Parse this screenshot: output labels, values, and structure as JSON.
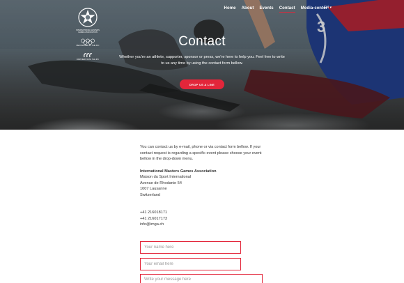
{
  "nav": {
    "items": [
      {
        "label": "Home",
        "active": false
      },
      {
        "label": "About",
        "active": false
      },
      {
        "label": "Events",
        "active": false
      },
      {
        "label": "Contact",
        "active": true
      },
      {
        "label": "Media-center",
        "active": false
      }
    ],
    "language": "EN ▾",
    "accent_color": "#e3263a"
  },
  "logos": {
    "main_text": "International Masters Games Association",
    "ioc_text": "Recognised by the IOC",
    "ipc_text": "Partners with the IPC"
  },
  "hero": {
    "title": "Contact",
    "subtitle": "Whether you're an athlete, supporter, sponsor or press, we're here to help you. Feel free to write to us any time by using the contact form bellow.",
    "button_label": "DROP US A LINE"
  },
  "content": {
    "intro": "You can contact us by e-mail, phone or via contact form bellow. If your contact request is regarding a specific event please choose your event bellow in the drop-down menu.",
    "org_name": "International Masters Games Association",
    "address": [
      "Maison du Sport International",
      "Avenue de Rhodanie 54",
      "1007 Lausanne",
      "Switzerland"
    ],
    "phone1": "+41 216018171",
    "phone2": "+41 216017173",
    "email": "info@imga.ch"
  },
  "form": {
    "name_placeholder": "Your name here",
    "email_placeholder": "Your email here",
    "message_placeholder": "Write your message here"
  }
}
